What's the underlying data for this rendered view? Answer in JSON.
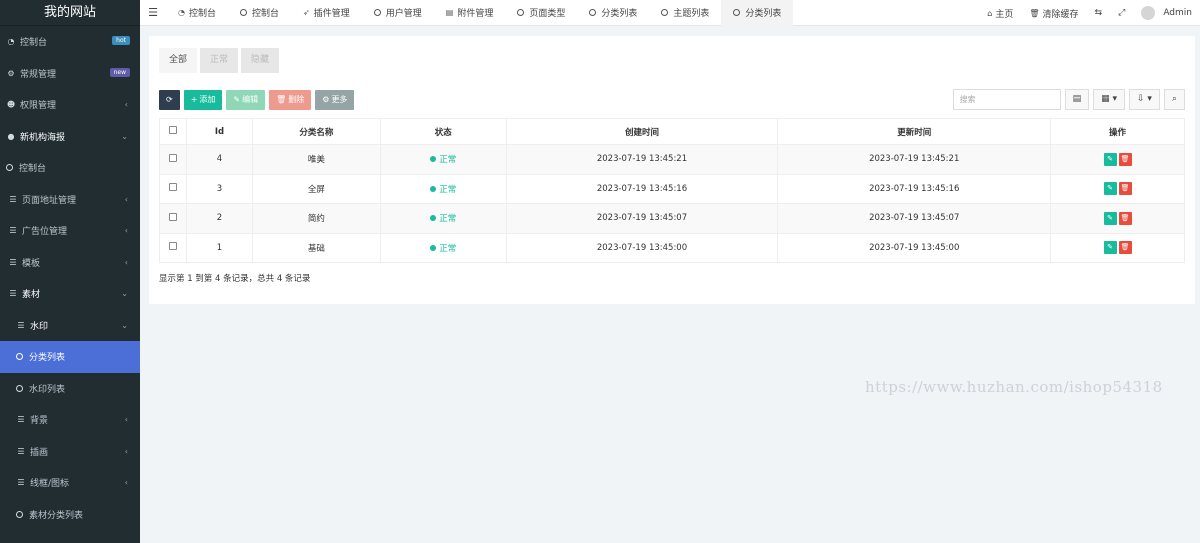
{
  "sidebar": {
    "title": "我的网站",
    "items": [
      {
        "label": "控制台",
        "icon": "dashboard-icon",
        "badge": "hot"
      },
      {
        "label": "常规管理",
        "icon": "cogs-icon",
        "badge": "new"
      },
      {
        "label": "权限管理",
        "icon": "users-icon",
        "arrow": "‹"
      },
      {
        "label": "新机构海报",
        "icon": "globe-icon",
        "arrow": "⌄"
      },
      {
        "label": "控制台",
        "icon": "circle-icon"
      },
      {
        "label": "页面地址管理",
        "icon": "list-icon",
        "arrow": "‹"
      },
      {
        "label": "广告位管理",
        "icon": "list-icon",
        "arrow": "‹"
      },
      {
        "label": "模板",
        "icon": "list-icon",
        "arrow": "‹"
      },
      {
        "label": "素材",
        "icon": "list-icon",
        "arrow": "⌄"
      },
      {
        "label": "水印",
        "icon": "list-icon",
        "arrow": "⌄"
      },
      {
        "label": "分类列表",
        "icon": "circle-icon"
      },
      {
        "label": "水印列表",
        "icon": "circle-icon"
      },
      {
        "label": "背景",
        "icon": "list-icon",
        "arrow": "‹"
      },
      {
        "label": "插画",
        "icon": "list-icon",
        "arrow": "‹"
      },
      {
        "label": "线框/图标",
        "icon": "list-icon",
        "arrow": "‹"
      },
      {
        "label": "素材分类列表",
        "icon": "circle-icon"
      }
    ]
  },
  "topbar": {
    "tabs": [
      {
        "label": "控制台",
        "icon": "dashboard-icon"
      },
      {
        "label": "控制台",
        "icon": "circle-icon"
      },
      {
        "label": "插件管理",
        "icon": "rocket-icon"
      },
      {
        "label": "用户管理",
        "icon": "circle-icon"
      },
      {
        "label": "附件管理",
        "icon": "file-image-icon"
      },
      {
        "label": "页面类型",
        "icon": "circle-icon"
      },
      {
        "label": "分类列表",
        "icon": "circle-icon"
      },
      {
        "label": "主题列表",
        "icon": "circle-icon"
      },
      {
        "label": "分类列表",
        "icon": "circle-icon"
      }
    ],
    "home": "主页",
    "clear_cache": "清除缓存",
    "user": "Admin"
  },
  "panel": {
    "tabs": [
      "全部",
      "正常",
      "隐藏"
    ],
    "toolbar": {
      "add": "添加",
      "edit": "编辑",
      "delete": "删除",
      "more": "更多"
    },
    "search_placeholder": "搜索",
    "columns": [
      "Id",
      "分类名称",
      "状态",
      "创建时间",
      "更新时间",
      "操作"
    ],
    "rows": [
      {
        "id": "4",
        "name": "唯美",
        "status": "正常",
        "created": "2023-07-19 13:45:21",
        "updated": "2023-07-19 13:45:21"
      },
      {
        "id": "3",
        "name": "全屏",
        "status": "正常",
        "created": "2023-07-19 13:45:16",
        "updated": "2023-07-19 13:45:16"
      },
      {
        "id": "2",
        "name": "简约",
        "status": "正常",
        "created": "2023-07-19 13:45:07",
        "updated": "2023-07-19 13:45:07"
      },
      {
        "id": "1",
        "name": "基础",
        "status": "正常",
        "created": "2023-07-19 13:45:00",
        "updated": "2023-07-19 13:45:00"
      }
    ],
    "page_info": "显示第 1 到第 4 条记录，总共 4 条记录"
  },
  "watermark": "https://www.huzhan.com/ishop54318",
  "colors": {
    "sidebar_bg": "#222d32",
    "active_item": "#4b6fd6",
    "success": "#18bc9c",
    "danger": "#e74c3c"
  }
}
